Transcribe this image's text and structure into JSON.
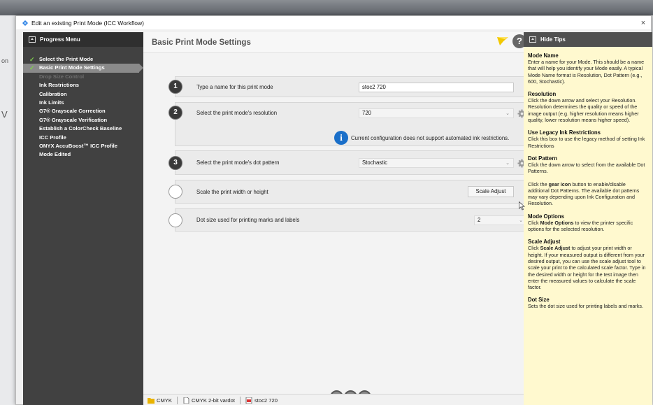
{
  "window": {
    "title": "Edit an existing Print Mode (ICC Workflow)",
    "close_label": "×"
  },
  "background": {
    "left_texts": [
      "on",
      "V"
    ]
  },
  "sidebar": {
    "header": "Progress Menu",
    "items": [
      {
        "label": "Select the Print Mode",
        "state": "done"
      },
      {
        "label": "Basic Print Mode Settings",
        "state": "current"
      },
      {
        "label": "Drop Size Control",
        "state": "disabled"
      },
      {
        "label": "Ink Restrictions",
        "state": "normal"
      },
      {
        "label": "Calibration",
        "state": "normal"
      },
      {
        "label": "Ink Limits",
        "state": "normal"
      },
      {
        "label": "G7® Grayscale Correction",
        "state": "normal"
      },
      {
        "label": "G7® Grayscale Verification",
        "state": "normal"
      },
      {
        "label": "Establish a ColorCheck Baseline",
        "state": "normal"
      },
      {
        "label": "ICC Profile",
        "state": "normal"
      },
      {
        "label": "ONYX AccuBoost™ ICC Profile",
        "state": "normal"
      },
      {
        "label": "Mode Edited",
        "state": "normal"
      }
    ]
  },
  "main": {
    "title": "Basic Print Mode Settings",
    "help_label": "?",
    "steps": {
      "name": {
        "number": "1",
        "label": "Type a name for this print mode",
        "value": "stoc2 720"
      },
      "resolution": {
        "number": "2",
        "label": "Select the print mode's resolution",
        "value": "720",
        "info_text": "Current configuration does not support automated ink restrictions."
      },
      "dot_pattern": {
        "number": "3",
        "label": "Select the print mode's dot pattern",
        "value": "Stochastic"
      },
      "scale": {
        "label": "Scale the print width or height",
        "button": "Scale Adjust"
      },
      "dot_size": {
        "label": "Dot size used for printing marks and labels",
        "value": "2"
      }
    },
    "chevron": "⌄"
  },
  "statusbar": {
    "items": [
      "CMYK",
      "CMYK 2-bit vardot",
      "stoc2 720"
    ]
  },
  "tips": {
    "header": "Hide Tips",
    "sections": [
      {
        "title": "Mode Name",
        "text": "Enter a name for your Mode. This should be a name that will help you identify your Mode easily. A typical Mode Name format is Resolution, Dot Pattern (e.g., 600, Stochastic)."
      },
      {
        "title": "Resolution",
        "text": "Click the down arrow and select your Resolution. Resolution determines the quality or speed of the image output (e.g. higher resolution means higher quality, lower resolution means higher speed)."
      },
      {
        "title": "Use Legacy Ink Restrictions",
        "text": "Click this box to use the legacy method of setting Ink Restrictions"
      },
      {
        "title": "Dot Pattern",
        "text": "Click the down arrow to select from the available Dot Patterns."
      },
      {
        "title": "",
        "pre": "Click the ",
        "bold": "gear icon",
        "post": " button to enable/disable additional Dot Patterns. The available dot patterns may vary depending upon Ink Configuration and Resolution."
      },
      {
        "title": "Mode Options",
        "pre": "Click ",
        "bold": "Mode Options",
        "post": " to view the printer specific options for the selected resolution."
      },
      {
        "title": "Scale Adjust",
        "pre": "Click ",
        "bold": "Scale Adjust",
        "post": " to adjust your print width or height. If your measured output is different from your desired output, you can use the scale adjust tool to scale your print to the calculated scale factor. Type in the desired width or height for the test image then enter the measured values to calculate the scale factor."
      },
      {
        "title": "Dot Size",
        "text": "Sets the dot size used for printing labels and marks."
      }
    ]
  },
  "colors": {
    "sidebar_bg": "#414141",
    "tips_bg": "#fff9cf",
    "check": "#7fd04b",
    "info": "#1a6fc9",
    "flag": "#f2c800"
  }
}
